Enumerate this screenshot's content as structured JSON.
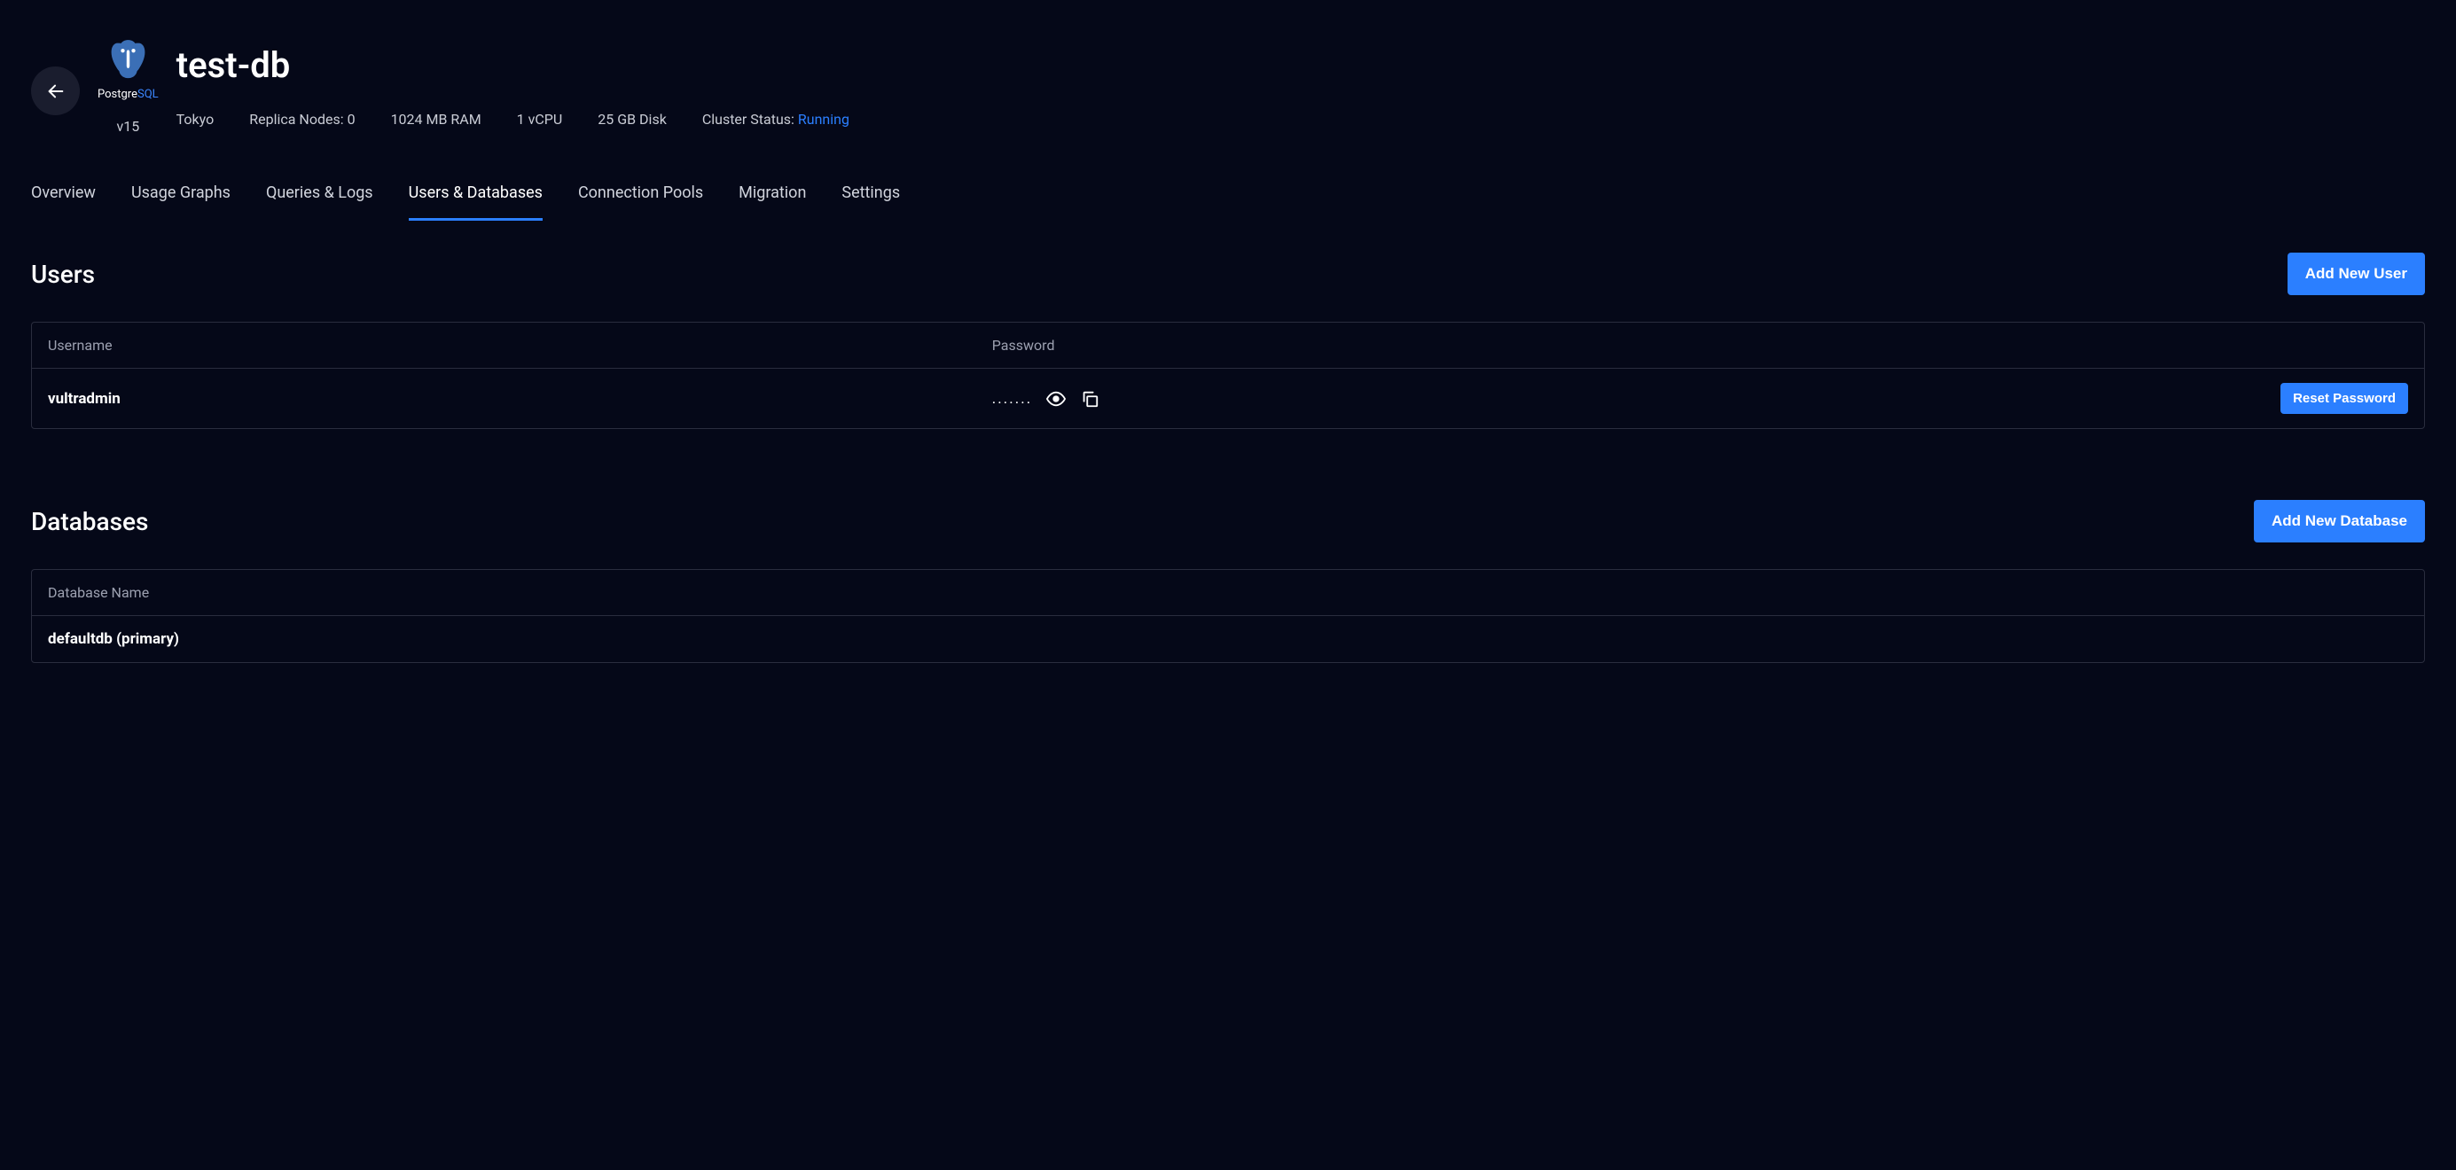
{
  "header": {
    "db_title": "test-db",
    "logo_label": "PostgreSQL",
    "version": "v15",
    "meta": {
      "location": "Tokyo",
      "replica_label": "Replica Nodes: ",
      "replica_value": "0",
      "ram": "1024 MB RAM",
      "cpu": "1 vCPU",
      "disk": "25 GB Disk",
      "cluster_status_label": "Cluster Status: ",
      "cluster_status_value": "Running"
    }
  },
  "tabs": [
    {
      "label": "Overview",
      "active": false
    },
    {
      "label": "Usage Graphs",
      "active": false
    },
    {
      "label": "Queries & Logs",
      "active": false
    },
    {
      "label": "Users & Databases",
      "active": true
    },
    {
      "label": "Connection Pools",
      "active": false
    },
    {
      "label": "Migration",
      "active": false
    },
    {
      "label": "Settings",
      "active": false
    }
  ],
  "users_section": {
    "title": "Users",
    "add_button": "Add New User",
    "columns": {
      "username": "Username",
      "password": "Password"
    },
    "rows": [
      {
        "username": "vultradmin",
        "password_masked": ".......",
        "reset_button": "Reset Password"
      }
    ]
  },
  "databases_section": {
    "title": "Databases",
    "add_button": "Add New Database",
    "columns": {
      "name": "Database Name"
    },
    "rows": [
      {
        "name": "defaultdb (primary)"
      }
    ]
  }
}
